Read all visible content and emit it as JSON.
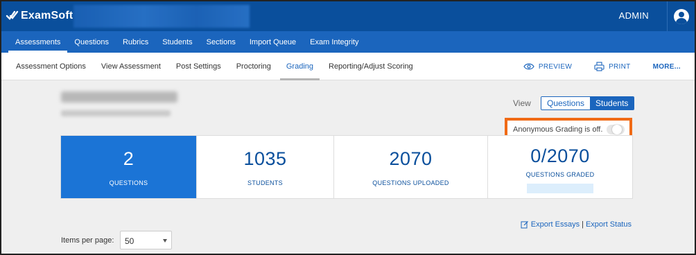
{
  "app": {
    "brand": "ExamSoft",
    "user_label": "ADMIN"
  },
  "main_nav": {
    "tabs": [
      {
        "label": "Assessments",
        "active": true
      },
      {
        "label": "Questions",
        "active": false
      },
      {
        "label": "Rubrics",
        "active": false
      },
      {
        "label": "Students",
        "active": false
      },
      {
        "label": "Sections",
        "active": false
      },
      {
        "label": "Import Queue",
        "active": false
      },
      {
        "label": "Exam Integrity",
        "active": false
      }
    ]
  },
  "sub_nav": {
    "items": [
      {
        "label": "Assessment Options",
        "active": false
      },
      {
        "label": "View Assessment",
        "active": false
      },
      {
        "label": "Post Settings",
        "active": false
      },
      {
        "label": "Proctoring",
        "active": false
      },
      {
        "label": "Grading",
        "active": true
      },
      {
        "label": "Reporting/Adjust Scoring",
        "active": false
      }
    ],
    "actions": {
      "preview": "PREVIEW",
      "print": "PRINT",
      "more": "MORE..."
    }
  },
  "view_toggle": {
    "label": "View",
    "options": [
      "Questions",
      "Students"
    ],
    "selected": "Students"
  },
  "anonymous_grading": {
    "text": "Anonymous Grading is off.",
    "enabled": false
  },
  "stats": [
    {
      "value": "2",
      "label": "QUESTIONS"
    },
    {
      "value": "1035",
      "label": "STUDENTS"
    },
    {
      "value": "2070",
      "label": "QUESTIONS UPLOADED"
    },
    {
      "value": "0/2070",
      "label": "QUESTIONS GRADED",
      "progress": 0
    }
  ],
  "exports": {
    "essays": "Export Essays",
    "separator": "|",
    "status": "Export Status"
  },
  "pagination": {
    "items_per_page_label": "Items per page:",
    "items_per_page_value": "50"
  },
  "colors": {
    "topbar": "#0a4f9c",
    "nav": "#1b65bd",
    "highlight": "#f06a15",
    "stat_primary": "#1b74d6"
  }
}
